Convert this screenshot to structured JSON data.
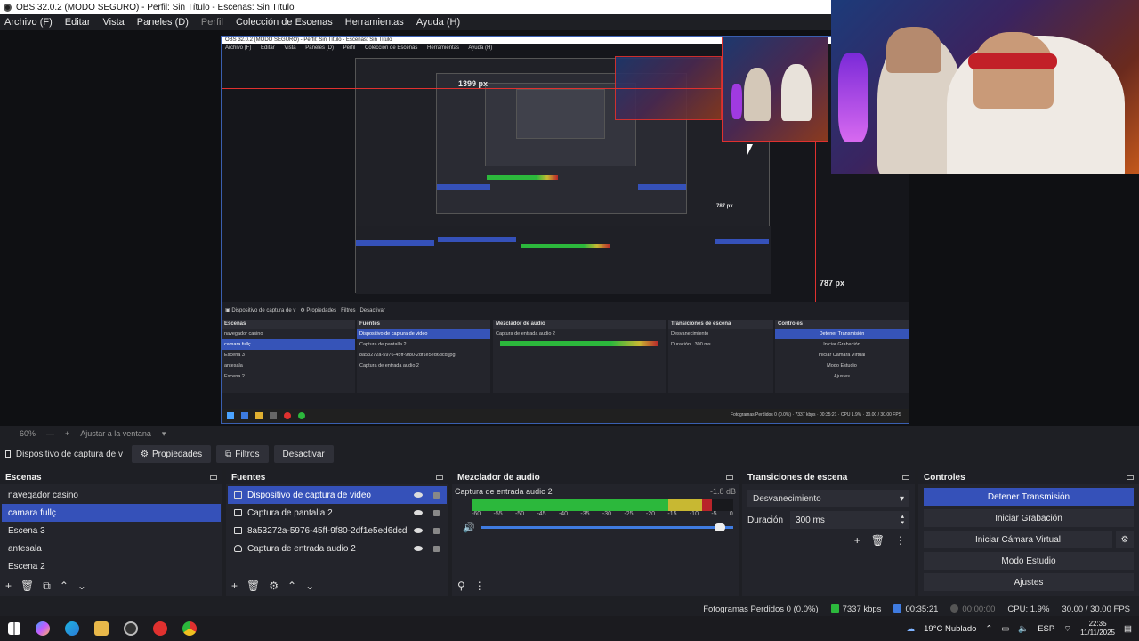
{
  "window": {
    "title": "OBS 32.0.2 (MODO SEGURO) - Perfil: Sin Título - Escenas: Sin Título"
  },
  "menu": [
    {
      "label": "Archivo (F)",
      "dim": false
    },
    {
      "label": "Editar",
      "dim": false
    },
    {
      "label": "Vista",
      "dim": false
    },
    {
      "label": "Paneles (D)",
      "dim": false
    },
    {
      "label": "Perfil",
      "dim": true
    },
    {
      "label": "Colección de Escenas",
      "dim": false
    },
    {
      "label": "Herramientas",
      "dim": false
    },
    {
      "label": "Ayuda (H)",
      "dim": false
    }
  ],
  "preview": {
    "label_width": "1399 px",
    "label_height_small": "787 px",
    "label_height": "787 px",
    "inner_title": "OBS 32.0.2 (MODO SEGURO) - Perfil: Sin Título - Escenas: Sin Título",
    "inner_menu": [
      "Archivo (F)",
      "Editar",
      "Vista",
      "Paneles (D)",
      "Perfil",
      "Colección de Escenas",
      "Herramientas",
      "Ayuda (H)"
    ]
  },
  "zoom": {
    "level": "60%",
    "fit_label": "Ajustar a la ventana"
  },
  "context": {
    "source": "Dispositivo de captura de v",
    "properties": "Propiedades",
    "filters": "Filtros",
    "deactivate": "Desactivar"
  },
  "scenes": {
    "title": "Escenas",
    "items": [
      "navegador casino",
      "camara fullç",
      "Escena 3",
      "antesala",
      "Escena 2"
    ],
    "selected": 1
  },
  "sources": {
    "title": "Fuentes",
    "items": [
      {
        "name": "Dispositivo de captura de video",
        "icon": "camera-icon"
      },
      {
        "name": "Captura de pantalla 2",
        "icon": "monitor-icon"
      },
      {
        "name": "8a53272a-5976-45ff-9f80-2df1e5ed6dcd.jpg",
        "icon": "image-icon"
      },
      {
        "name": "Captura de entrada audio 2",
        "icon": "microphone-icon"
      }
    ],
    "selected": 0
  },
  "mixer": {
    "title": "Mezclador de audio",
    "channel": "Captura de entrada audio 2",
    "db": "-1.8 dB",
    "ticks": [
      "-60",
      "-55",
      "-50",
      "-45",
      "-40",
      "-35",
      "-30",
      "-25",
      "-20",
      "-15",
      "-10",
      "-5",
      "0"
    ],
    "level": 0.92,
    "volume": 0.97
  },
  "transitions": {
    "title": "Transiciones de escena",
    "selected": "Desvanecimiento",
    "duration_label": "Duración",
    "duration": "300 ms"
  },
  "controls": {
    "title": "Controles",
    "stop_stream": "Detener Transmisión",
    "start_recording": "Iniciar Grabación",
    "start_virtual_cam": "Iniciar Cámara Virtual",
    "studio_mode": "Modo Estudio",
    "settings": "Ajustes"
  },
  "status": {
    "dropped": "Fotogramas Perdidos 0 (0.0%)",
    "bitrate": "7337 kbps",
    "stream_time": "00:35:21",
    "rec_time": "00:00:00",
    "cpu": "CPU: 1.9%",
    "fps": "30.00 / 30.00 FPS"
  },
  "taskbar": {
    "weather": "19°C  Nublado",
    "lang": "ESP",
    "time": "22:35",
    "date": "11/11/2025"
  },
  "colors": {
    "accent": "#3551b9",
    "live_red": "#e0312f",
    "stream_green": "#2cb83c"
  }
}
